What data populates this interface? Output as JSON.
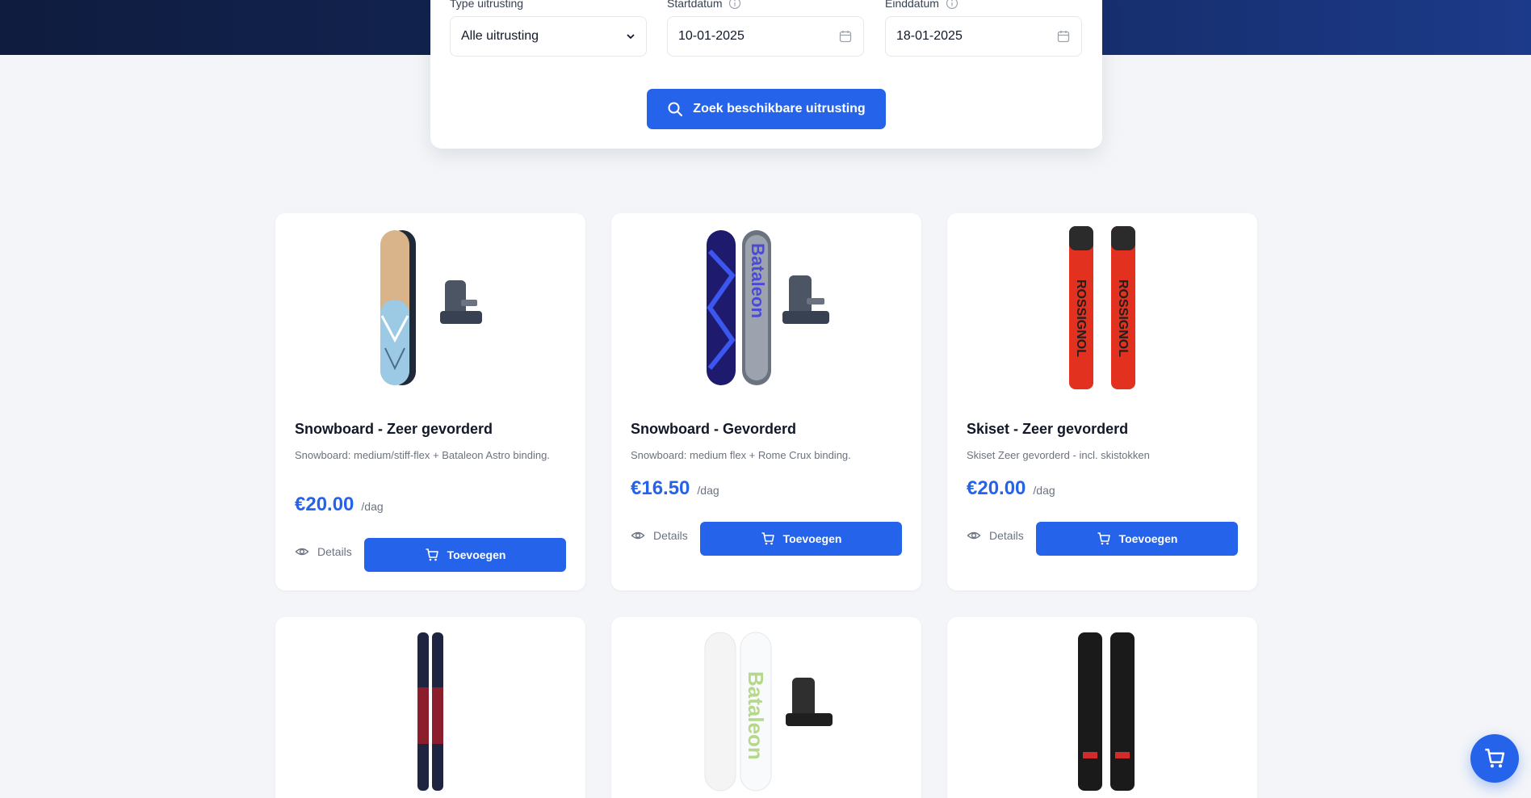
{
  "search": {
    "type_label": "Type uitrusting",
    "type_value": "Alle uitrusting",
    "start_label": "Startdatum",
    "start_value": "10-01-2025",
    "end_label": "Einddatum",
    "end_value": "18-01-2025",
    "button_label": "Zoek beschikbare uitrusting"
  },
  "colors": {
    "accent": "#2563eb",
    "header_dark": "#0f1c3f",
    "background": "#f3f5f8"
  },
  "products": [
    {
      "title": "Snowboard - Zeer gevorderd",
      "description": "Snowboard: medium/stiff-flex + Bataleon Astro binding.",
      "price": "€20.00",
      "per": "/dag",
      "details_label": "Details",
      "add_label": "Toevoegen"
    },
    {
      "title": "Snowboard - Gevorderd",
      "description": "Snowboard: medium flex + Rome Crux binding.",
      "price": "€16.50",
      "per": "/dag",
      "details_label": "Details",
      "add_label": "Toevoegen",
      "board_text": "Bataleon"
    },
    {
      "title": "Skiset - Zeer gevorderd",
      "description": "Skiset Zeer gevorderd - incl. skistokken",
      "price": "€20.00",
      "per": "/dag",
      "details_label": "Details",
      "add_label": "Toevoegen",
      "ski_text": "ROSSIGNOL"
    },
    {},
    {
      "board_text": "Bataleon"
    },
    {}
  ],
  "icons": {
    "search": "search-icon",
    "calendar": "calendar-icon",
    "info": "info-icon",
    "eye": "eye-icon",
    "cart": "cart-icon",
    "chevron": "chevron-down-icon"
  }
}
